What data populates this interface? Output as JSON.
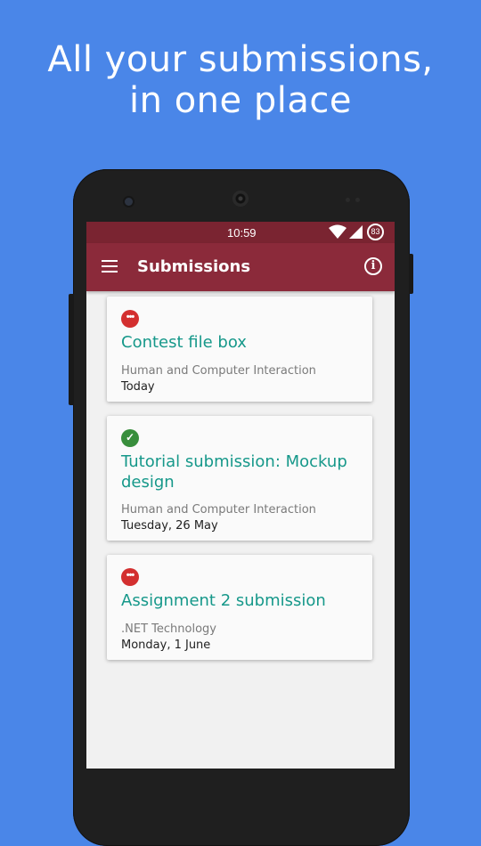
{
  "headline": {
    "line1": "All your submissions,",
    "line2": "in one place"
  },
  "statusbar": {
    "time": "10:59",
    "battery": "83"
  },
  "toolbar": {
    "title": "Submissions",
    "menu_icon": "menu-icon",
    "info_icon": "info-icon"
  },
  "colors": {
    "background": "#4a86e8",
    "statusbar": "#7a2431",
    "toolbar": "#8b2a3a",
    "title_teal": "#16988a",
    "pending_red": "#d32f2f",
    "done_green": "#388e3c"
  },
  "submissions": [
    {
      "status": "pending",
      "status_icon": "more-dots-icon",
      "title": "Contest file box",
      "course": "Human and Computer Interaction",
      "date": "Today"
    },
    {
      "status": "done",
      "status_icon": "check-circle-icon",
      "title": "Tutorial submission: Mockup design",
      "course": "Human and Computer Interaction",
      "date": "Tuesday, 26 May"
    },
    {
      "status": "pending",
      "status_icon": "more-dots-icon",
      "title": "Assignment 2 submission",
      "course": ".NET Technology",
      "date": "Monday, 1 June"
    }
  ]
}
